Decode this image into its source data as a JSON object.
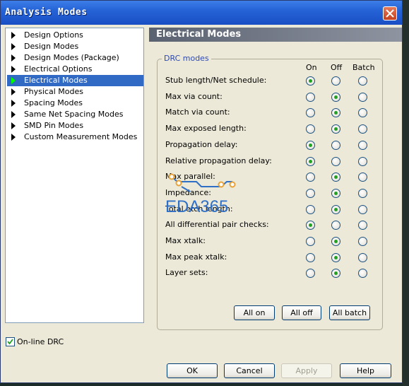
{
  "window": {
    "title": "Analysis Modes"
  },
  "nav": {
    "items": [
      {
        "label": "Design Options",
        "selected": false
      },
      {
        "label": "Design Modes",
        "selected": false
      },
      {
        "label": "Design Modes (Package)",
        "selected": false
      },
      {
        "label": "Electrical Options",
        "selected": false
      },
      {
        "label": "Electrical Modes",
        "selected": true
      },
      {
        "label": "Physical Modes",
        "selected": false
      },
      {
        "label": "Spacing Modes",
        "selected": false
      },
      {
        "label": "Same Net Spacing Modes",
        "selected": false
      },
      {
        "label": "SMD Pin Modes",
        "selected": false
      },
      {
        "label": "Custom Measurement Modes",
        "selected": false
      }
    ]
  },
  "panel": {
    "title": "Electrical Modes",
    "group_label": "DRC modes",
    "columns": [
      "On",
      "Off",
      "Batch"
    ],
    "rows": [
      {
        "label": "Stub length/Net schedule:",
        "value": "On"
      },
      {
        "label": "Max via count:",
        "value": "Off"
      },
      {
        "label": "Match via count:",
        "value": "Off"
      },
      {
        "label": "Max exposed length:",
        "value": "Off"
      },
      {
        "label": "Propagation delay:",
        "value": "On"
      },
      {
        "label": "Relative propagation delay:",
        "value": "On"
      },
      {
        "label": "Max parallel:",
        "value": "Off"
      },
      {
        "label": "Impedance:",
        "value": "Off"
      },
      {
        "label": "Total etch length:",
        "value": "Off"
      },
      {
        "label": "All differential pair checks:",
        "value": "On"
      },
      {
        "label": "Max xtalk:",
        "value": "Off"
      },
      {
        "label": "Max peak xtalk:",
        "value": "Off"
      },
      {
        "label": "Layer sets:",
        "value": "Off"
      }
    ],
    "buttons": {
      "all_on": "All on",
      "all_off": "All off",
      "all_batch": "All batch"
    }
  },
  "online_drc": {
    "label": "On-line DRC",
    "checked": true
  },
  "footer": {
    "ok": "OK",
    "cancel": "Cancel",
    "apply": "Apply",
    "help": "Help"
  },
  "watermark": {
    "text": "EDA365"
  },
  "colors": {
    "title_bar": "#2563d6",
    "selection": "#316ac5",
    "radio_dot": "#21a121",
    "watermark": "#2f6fc6"
  }
}
